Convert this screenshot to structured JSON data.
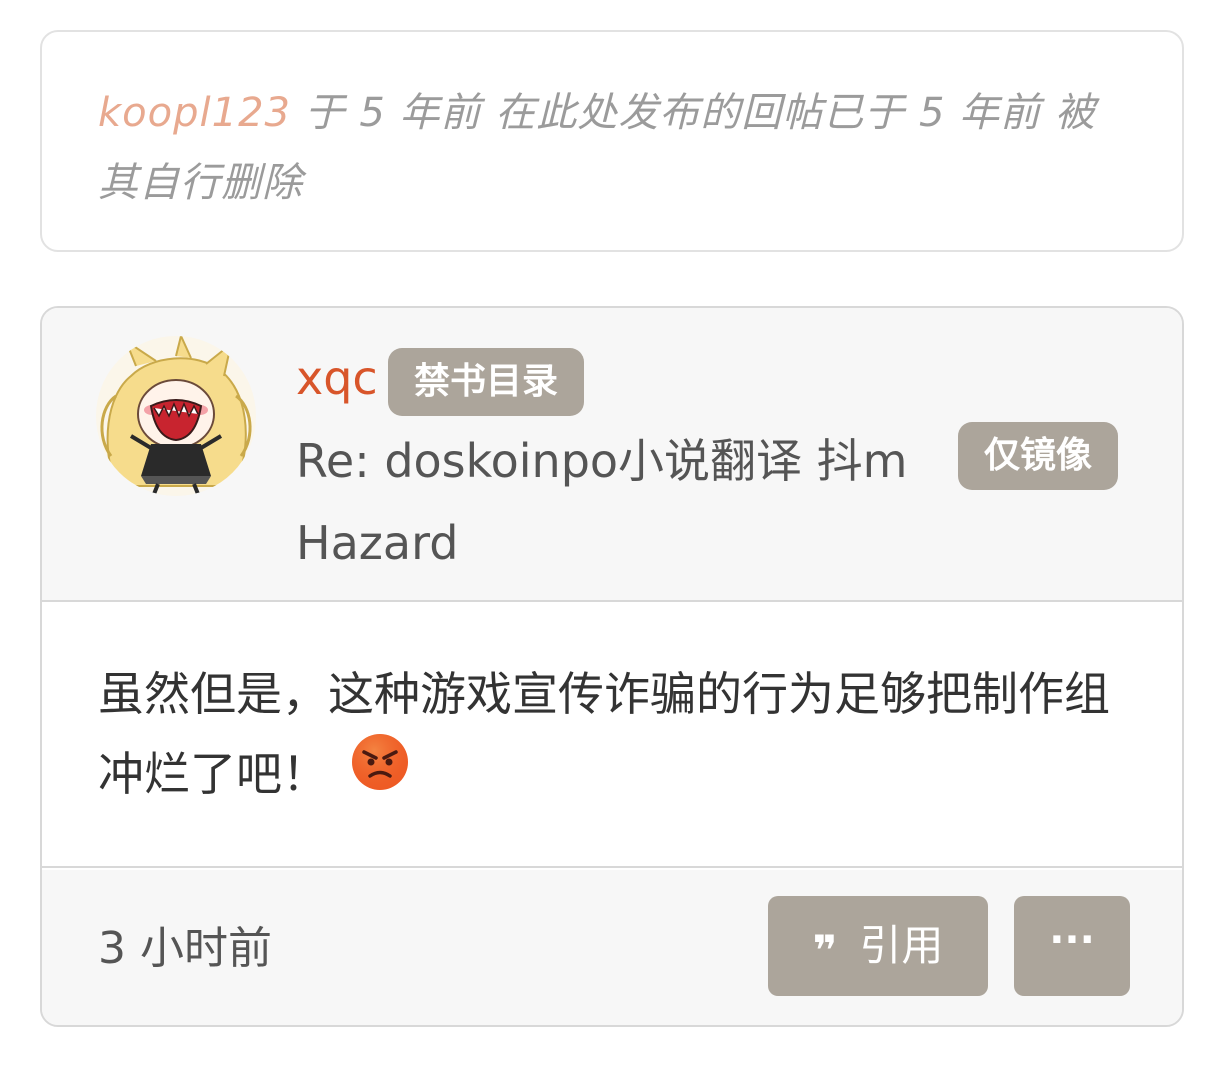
{
  "deleted_notice": {
    "user": "koopl123",
    "message": " 于 5 年前 在此处发布的回帖已于 5 年前 被其自行删除"
  },
  "post": {
    "username": "xqc",
    "group_badge": "禁书目录",
    "title": "Re: doskoinpo小说翻译 抖m Hazard",
    "mirror_badge": "仅镜像",
    "body": "虽然但是，这种游戏宣传诈骗的行为足够把制作组冲烂了吧！",
    "emoji": "angry-face",
    "timestamp": "3 小时前",
    "quote_label": "引用",
    "quote_icon": "quote-icon",
    "more_label": "···"
  },
  "colors": {
    "username": "#d8552a",
    "deleted_user": "#e8a98f",
    "badge_bg": "#aca59b",
    "header_bg": "#f7f7f7"
  }
}
